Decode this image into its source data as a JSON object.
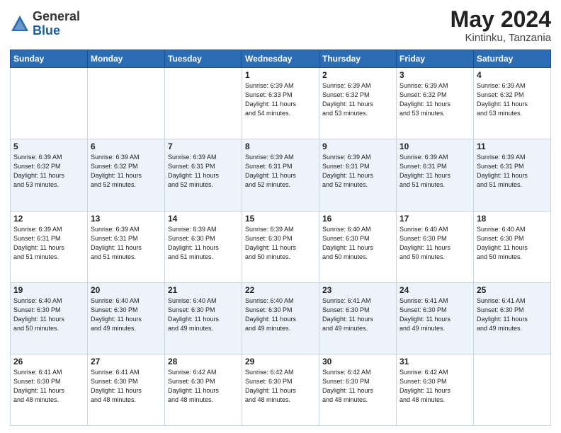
{
  "logo": {
    "general": "General",
    "blue": "Blue"
  },
  "title": "May 2024",
  "location": "Kintinku, Tanzania",
  "headers": [
    "Sunday",
    "Monday",
    "Tuesday",
    "Wednesday",
    "Thursday",
    "Friday",
    "Saturday"
  ],
  "weeks": [
    [
      {
        "day": "",
        "info": ""
      },
      {
        "day": "",
        "info": ""
      },
      {
        "day": "",
        "info": ""
      },
      {
        "day": "1",
        "info": "Sunrise: 6:39 AM\nSunset: 6:33 PM\nDaylight: 11 hours\nand 54 minutes."
      },
      {
        "day": "2",
        "info": "Sunrise: 6:39 AM\nSunset: 6:32 PM\nDaylight: 11 hours\nand 53 minutes."
      },
      {
        "day": "3",
        "info": "Sunrise: 6:39 AM\nSunset: 6:32 PM\nDaylight: 11 hours\nand 53 minutes."
      },
      {
        "day": "4",
        "info": "Sunrise: 6:39 AM\nSunset: 6:32 PM\nDaylight: 11 hours\nand 53 minutes."
      }
    ],
    [
      {
        "day": "5",
        "info": "Sunrise: 6:39 AM\nSunset: 6:32 PM\nDaylight: 11 hours\nand 53 minutes."
      },
      {
        "day": "6",
        "info": "Sunrise: 6:39 AM\nSunset: 6:32 PM\nDaylight: 11 hours\nand 52 minutes."
      },
      {
        "day": "7",
        "info": "Sunrise: 6:39 AM\nSunset: 6:31 PM\nDaylight: 11 hours\nand 52 minutes."
      },
      {
        "day": "8",
        "info": "Sunrise: 6:39 AM\nSunset: 6:31 PM\nDaylight: 11 hours\nand 52 minutes."
      },
      {
        "day": "9",
        "info": "Sunrise: 6:39 AM\nSunset: 6:31 PM\nDaylight: 11 hours\nand 52 minutes."
      },
      {
        "day": "10",
        "info": "Sunrise: 6:39 AM\nSunset: 6:31 PM\nDaylight: 11 hours\nand 51 minutes."
      },
      {
        "day": "11",
        "info": "Sunrise: 6:39 AM\nSunset: 6:31 PM\nDaylight: 11 hours\nand 51 minutes."
      }
    ],
    [
      {
        "day": "12",
        "info": "Sunrise: 6:39 AM\nSunset: 6:31 PM\nDaylight: 11 hours\nand 51 minutes."
      },
      {
        "day": "13",
        "info": "Sunrise: 6:39 AM\nSunset: 6:31 PM\nDaylight: 11 hours\nand 51 minutes."
      },
      {
        "day": "14",
        "info": "Sunrise: 6:39 AM\nSunset: 6:30 PM\nDaylight: 11 hours\nand 51 minutes."
      },
      {
        "day": "15",
        "info": "Sunrise: 6:39 AM\nSunset: 6:30 PM\nDaylight: 11 hours\nand 50 minutes."
      },
      {
        "day": "16",
        "info": "Sunrise: 6:40 AM\nSunset: 6:30 PM\nDaylight: 11 hours\nand 50 minutes."
      },
      {
        "day": "17",
        "info": "Sunrise: 6:40 AM\nSunset: 6:30 PM\nDaylight: 11 hours\nand 50 minutes."
      },
      {
        "day": "18",
        "info": "Sunrise: 6:40 AM\nSunset: 6:30 PM\nDaylight: 11 hours\nand 50 minutes."
      }
    ],
    [
      {
        "day": "19",
        "info": "Sunrise: 6:40 AM\nSunset: 6:30 PM\nDaylight: 11 hours\nand 50 minutes."
      },
      {
        "day": "20",
        "info": "Sunrise: 6:40 AM\nSunset: 6:30 PM\nDaylight: 11 hours\nand 49 minutes."
      },
      {
        "day": "21",
        "info": "Sunrise: 6:40 AM\nSunset: 6:30 PM\nDaylight: 11 hours\nand 49 minutes."
      },
      {
        "day": "22",
        "info": "Sunrise: 6:40 AM\nSunset: 6:30 PM\nDaylight: 11 hours\nand 49 minutes."
      },
      {
        "day": "23",
        "info": "Sunrise: 6:41 AM\nSunset: 6:30 PM\nDaylight: 11 hours\nand 49 minutes."
      },
      {
        "day": "24",
        "info": "Sunrise: 6:41 AM\nSunset: 6:30 PM\nDaylight: 11 hours\nand 49 minutes."
      },
      {
        "day": "25",
        "info": "Sunrise: 6:41 AM\nSunset: 6:30 PM\nDaylight: 11 hours\nand 49 minutes."
      }
    ],
    [
      {
        "day": "26",
        "info": "Sunrise: 6:41 AM\nSunset: 6:30 PM\nDaylight: 11 hours\nand 48 minutes."
      },
      {
        "day": "27",
        "info": "Sunrise: 6:41 AM\nSunset: 6:30 PM\nDaylight: 11 hours\nand 48 minutes."
      },
      {
        "day": "28",
        "info": "Sunrise: 6:42 AM\nSunset: 6:30 PM\nDaylight: 11 hours\nand 48 minutes."
      },
      {
        "day": "29",
        "info": "Sunrise: 6:42 AM\nSunset: 6:30 PM\nDaylight: 11 hours\nand 48 minutes."
      },
      {
        "day": "30",
        "info": "Sunrise: 6:42 AM\nSunset: 6:30 PM\nDaylight: 11 hours\nand 48 minutes."
      },
      {
        "day": "31",
        "info": "Sunrise: 6:42 AM\nSunset: 6:30 PM\nDaylight: 11 hours\nand 48 minutes."
      },
      {
        "day": "",
        "info": ""
      }
    ]
  ]
}
